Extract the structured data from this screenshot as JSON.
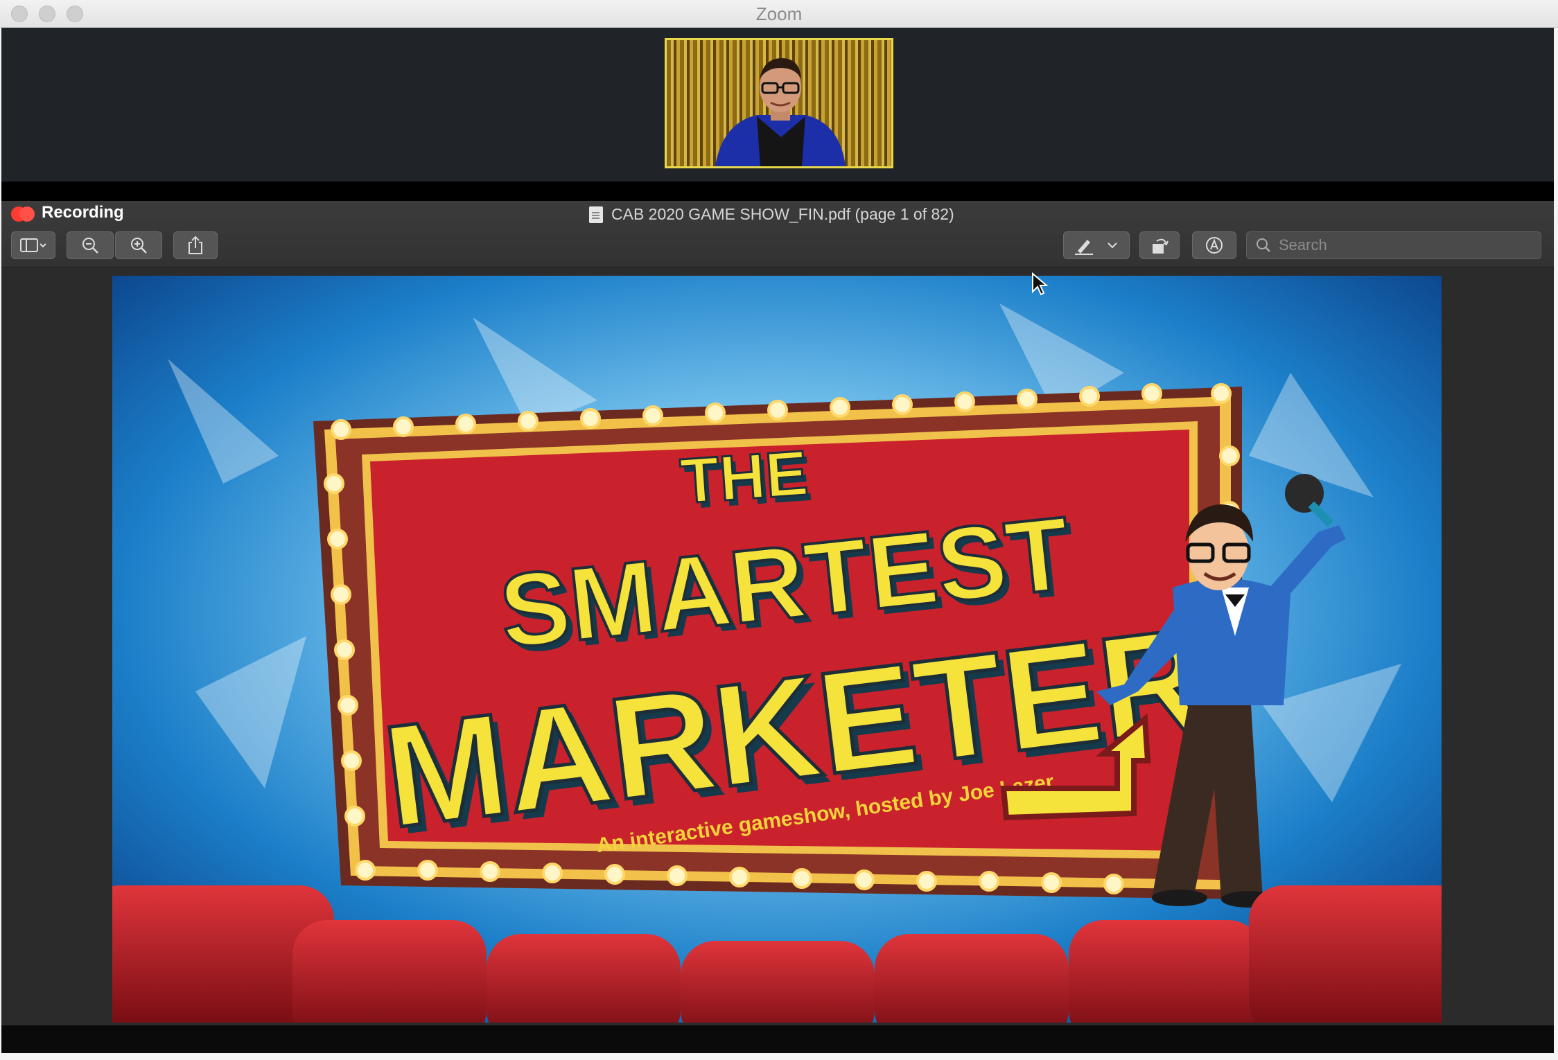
{
  "window": {
    "title": "Zoom"
  },
  "preview": {
    "recording_label": "Recording",
    "document_title": "CAB 2020 GAME SHOW_FIN.pdf (page 1 of 82)",
    "search_placeholder": "Search"
  },
  "slide": {
    "line1": "THE",
    "line2": "SMARTEST",
    "line3": "MARKETER",
    "tagline": "An interactive gameshow, hosted by Joe Lazer"
  },
  "icons": {
    "sidebar": "sidebar-icon",
    "zoom_out": "zoom-out-icon",
    "zoom_in": "zoom-in-icon",
    "share": "share-icon",
    "markup": "pen-icon",
    "rotate": "rotate-icon",
    "annotate": "annotate-icon",
    "search": "search-icon"
  },
  "colors": {
    "recording": "#ff3b30",
    "video_border": "#e8d84a",
    "marquee_red": "#c9222c",
    "letters_yellow": "#f5e23a"
  }
}
